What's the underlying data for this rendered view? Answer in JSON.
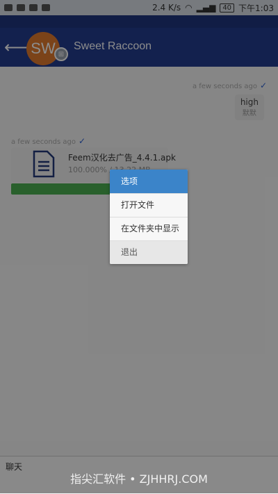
{
  "status_bar": {
    "speed": "2.4 K/s",
    "battery": "40",
    "time": "下午1:03"
  },
  "header": {
    "avatar_initials": "SW",
    "contact_name": "Sweet Raccoon"
  },
  "messages": {
    "right_time": "a few seconds ago",
    "right_text": "high",
    "right_sub": "默默",
    "left_time": "a few seconds ago",
    "file_name": "Feem汉化去广告_4.4.1.apk",
    "file_progress": "100.000% / 13.22 MB",
    "progress_fraction": 1.0
  },
  "dialog": {
    "title": "选项",
    "items": [
      "打开文件",
      "在文件夹中显示",
      "退出"
    ]
  },
  "input": {
    "placeholder": "聊天"
  },
  "watermark": "指尖汇软件 • ZJHHRJ.COM",
  "colors": {
    "app_bar": "#233c8f",
    "dialog_title": "#3b84c9",
    "progress": "#4caf50",
    "avatar": "#e07a2f"
  }
}
